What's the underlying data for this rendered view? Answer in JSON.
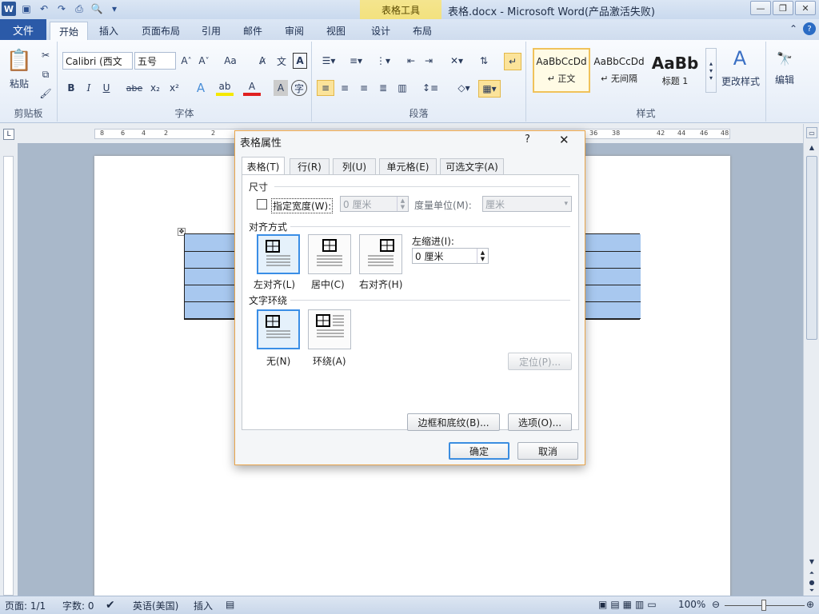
{
  "titlebar": {
    "title": "表格.docx - Microsoft Word(产品激活失败)",
    "context_tab_group": "表格工具",
    "word_logo": "W"
  },
  "tabs": {
    "file": "文件",
    "items": [
      "开始",
      "插入",
      "页面布局",
      "引用",
      "邮件",
      "审阅",
      "视图",
      "设计",
      "布局"
    ]
  },
  "ribbon": {
    "clipboard": {
      "paste": "粘贴",
      "label": "剪贴板"
    },
    "font": {
      "font_name": "Calibri (西文",
      "font_size": "五号",
      "label": "字体",
      "b": "B",
      "i": "I",
      "u": "U",
      "abc": "abe",
      "sub": "x₂",
      "sup": "x²",
      "aa": "Aa"
    },
    "paragraph": {
      "label": "段落"
    },
    "styles": {
      "label": "样式",
      "items": [
        {
          "preview": "AaBbCcDd",
          "name": "↵ 正文"
        },
        {
          "preview": "AaBbCcDd",
          "name": "↵ 无间隔"
        },
        {
          "preview": "AaBb",
          "name": "标题 1"
        }
      ],
      "change_styles": "更改样式"
    },
    "editing": {
      "label": "编辑"
    }
  },
  "ruler": {
    "ticks_left": [
      "8",
      "6",
      "4",
      "2",
      "",
      "2"
    ],
    "ticks_right": [
      "36",
      "38",
      "",
      "42",
      "44",
      "46",
      "48"
    ]
  },
  "dialog": {
    "title": "表格属性",
    "help": "?",
    "close": "✕",
    "tabs": [
      "表格(T)",
      "行(R)",
      "列(U)",
      "单元格(E)",
      "可选文字(A)"
    ],
    "size_section": "尺寸",
    "preferred_width_label": "指定宽度(W):",
    "preferred_width_value": "0 厘米",
    "measure_unit_label": "度量单位(M):",
    "measure_unit_value": "厘米",
    "alignment_section": "对齐方式",
    "align_options": [
      "左对齐(L)",
      "居中(C)",
      "右对齐(H)"
    ],
    "indent_label": "左缩进(I):",
    "indent_value": "0 厘米",
    "wrap_section": "文字环绕",
    "wrap_options": [
      "无(N)",
      "环绕(A)"
    ],
    "positioning_button": "定位(P)...",
    "borders_button": "边框和底纹(B)...",
    "options_button": "选项(O)...",
    "ok": "确定",
    "cancel": "取消"
  },
  "statusbar": {
    "page": "页面: 1/1",
    "words": "字数: 0",
    "language": "英语(美国)",
    "insert_mode": "插入",
    "zoom": "100%"
  }
}
